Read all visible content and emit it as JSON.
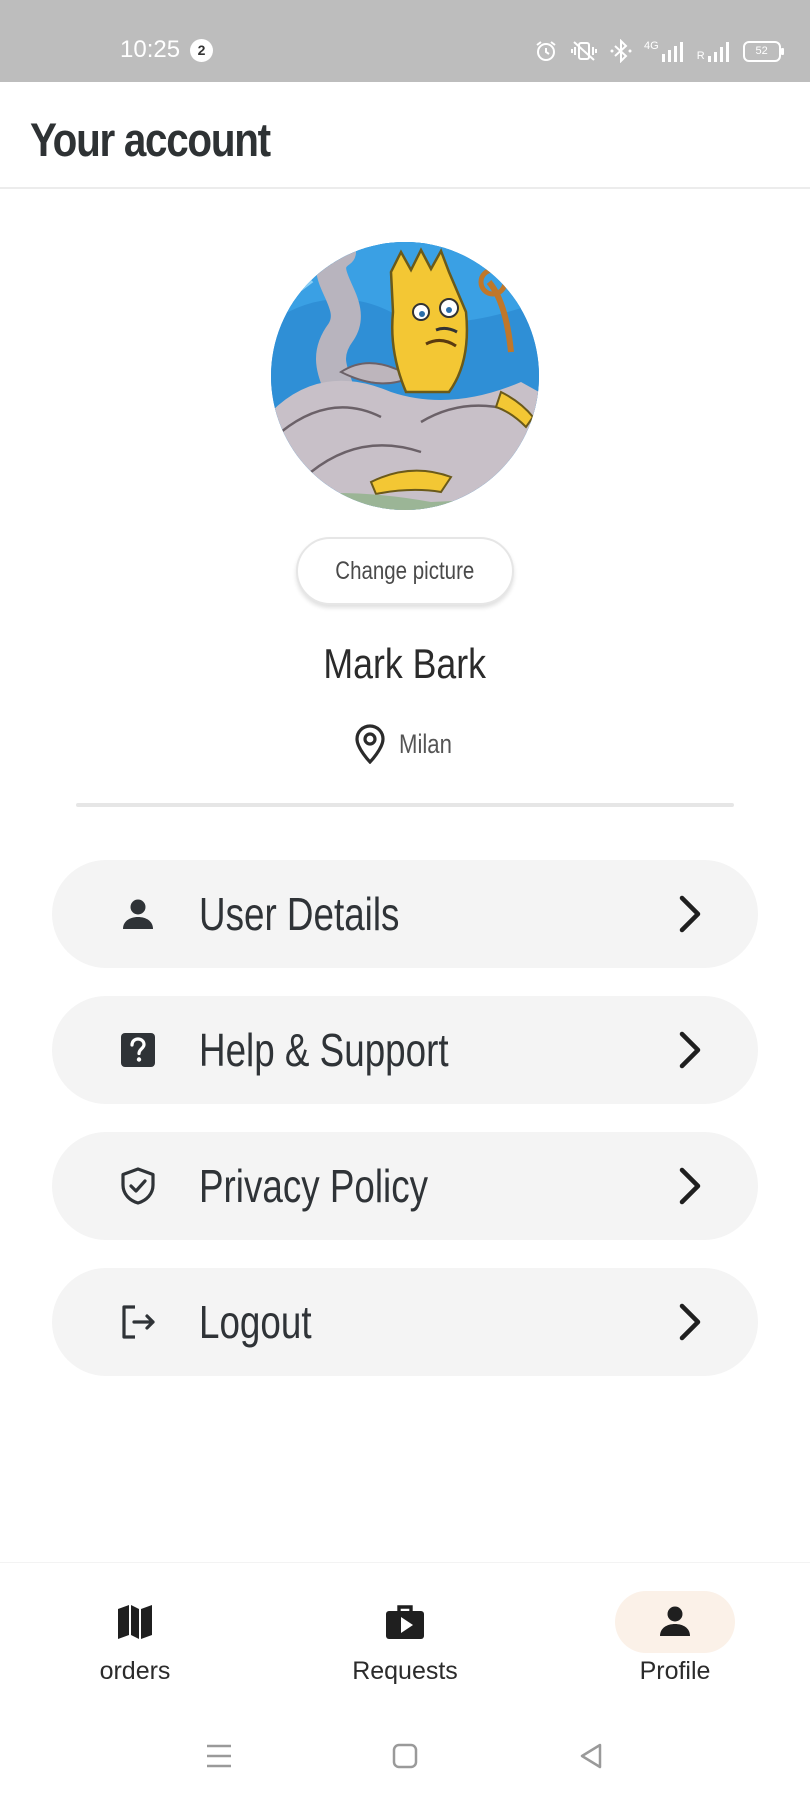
{
  "status_bar": {
    "time": "10:25",
    "notification_count": "2",
    "network_label": "4G",
    "roaming_label": "R",
    "battery_level": "52",
    "text_color": "#ffffff",
    "background": "#bdbdbd"
  },
  "header": {
    "title": "Your account"
  },
  "profile": {
    "change_picture_label": "Change picture",
    "name": "Mark Bark",
    "location": "Milan"
  },
  "menu": {
    "items": [
      {
        "label": "User Details",
        "icon": "person-icon"
      },
      {
        "label": "Help & Support",
        "icon": "help-icon"
      },
      {
        "label": "Privacy Policy",
        "icon": "shield-check-icon"
      },
      {
        "label": "Logout",
        "icon": "logout-icon"
      }
    ],
    "item_background": "#f4f4f4"
  },
  "bottom_nav": {
    "items": [
      {
        "label": "orders",
        "icon": "map-icon",
        "active": false
      },
      {
        "label": "Requests",
        "icon": "briefcase-play-icon",
        "active": false
      },
      {
        "label": "Profile",
        "icon": "person-icon",
        "active": true
      }
    ],
    "active_background": "#fbf1e8"
  },
  "system_nav": {
    "buttons": [
      "menu-icon",
      "home-icon",
      "back-icon"
    ]
  }
}
